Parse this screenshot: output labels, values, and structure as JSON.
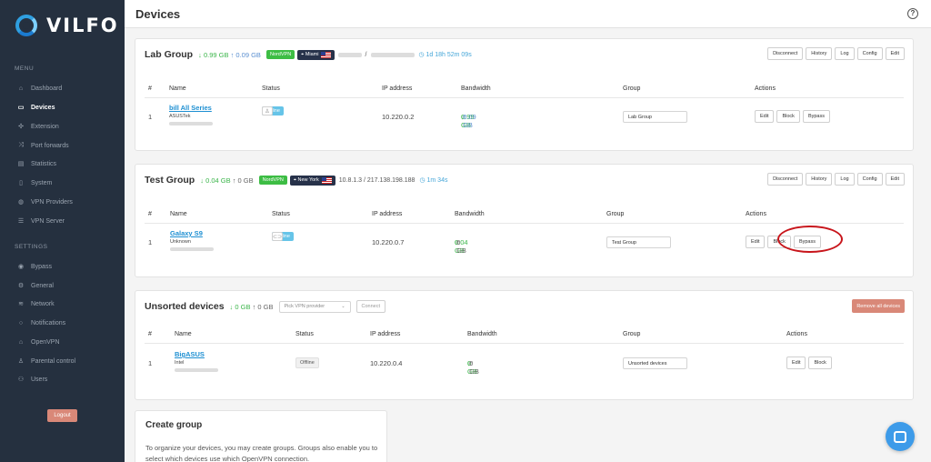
{
  "app": {
    "logo_text": "VILFO"
  },
  "sidebar": {
    "menu_label": "MENU",
    "menu_items": [
      {
        "label": "Dashboard",
        "icon": "home-icon"
      },
      {
        "label": "Devices",
        "icon": "laptop-icon",
        "active": true
      },
      {
        "label": "Extension",
        "icon": "puzzle-icon"
      },
      {
        "label": "Port forwards",
        "icon": "shuffle-icon"
      },
      {
        "label": "Statistics",
        "icon": "bar-chart-icon"
      },
      {
        "label": "System",
        "icon": "server-icon"
      },
      {
        "label": "VPN Providers",
        "icon": "globe-icon"
      },
      {
        "label": "VPN Server",
        "icon": "list-icon"
      }
    ],
    "settings_label": "SETTINGS",
    "settings_items": [
      {
        "label": "Bypass",
        "icon": "eye-icon"
      },
      {
        "label": "General",
        "icon": "gear-icon"
      },
      {
        "label": "Network",
        "icon": "wifi-icon"
      },
      {
        "label": "Notifications",
        "icon": "chat-icon"
      },
      {
        "label": "OpenVPN",
        "icon": "lock-icon"
      },
      {
        "label": "Parental control",
        "icon": "person-icon"
      },
      {
        "label": "Users",
        "icon": "users-icon"
      }
    ],
    "logout_label": "Logout"
  },
  "header": {
    "title": "Devices",
    "help_glyph": "?"
  },
  "groups": {
    "lab": {
      "title": "Lab Group",
      "down": "0.99 GB",
      "up": "0.09 GB",
      "vpn_badge": "NordVPN",
      "location": "Miami",
      "ip_separator": "/",
      "uptime": "1d 18h 52m 09s",
      "actions": [
        "Disconnect",
        "History",
        "Log",
        "Config",
        "Edit"
      ],
      "columns": [
        "#",
        "Name",
        "Status",
        "IP address",
        "Bandwidth",
        "Group",
        "Actions"
      ],
      "device": {
        "index": "1",
        "name": "bill All Series",
        "vendor": "ASUSTek",
        "status": "Online",
        "ip": "10.220.0.2",
        "down": "0.99 GB",
        "up": "0.09 GB",
        "group": "Lab Group",
        "actions": [
          "Edit",
          "Block",
          "Bypass"
        ]
      }
    },
    "test": {
      "title": "Test Group",
      "down": "0.04 GB",
      "up": "0 GB",
      "vpn_badge": "NordVPN",
      "location": "New York",
      "ip_info": "10.8.1.3 / 217.138.198.188",
      "uptime": "1m 34s",
      "actions": [
        "Disconnect",
        "History",
        "Log",
        "Config",
        "Edit"
      ],
      "columns": [
        "#",
        "Name",
        "Status",
        "IP address",
        "Bandwidth",
        "Group",
        "Actions"
      ],
      "device": {
        "index": "1",
        "name": "Galaxy S9",
        "vendor": "Unknown",
        "status": "Online",
        "ip": "10.220.0.7",
        "down": "0.04 GB",
        "up": "0 GB",
        "group": "Test Group",
        "actions": [
          "Edit",
          "Block",
          "Bypass"
        ]
      }
    },
    "unsorted": {
      "title": "Unsorted devices",
      "down": "0 GB",
      "up": "0 GB",
      "vpn_placeholder": "Pick VPN provider",
      "connect_label": "Connect",
      "remove_all_label": "Remove all devices",
      "columns": [
        "#",
        "Name",
        "Status",
        "IP address",
        "Bandwidth",
        "Group",
        "Actions"
      ],
      "device": {
        "index": "1",
        "name": "BigASUS",
        "vendor": "Intel",
        "status": "Offline",
        "ip": "10.220.0.4",
        "down": "0 GB",
        "up": "0 GB",
        "group": "Unsorted devices",
        "actions": [
          "Edit",
          "Block"
        ]
      }
    }
  },
  "create_group": {
    "title": "Create group",
    "description": "To organize your devices, you may create groups. Groups also enable you to select which devices use which OpenVPN connection."
  },
  "colors": {
    "accent": "#1d8fd2",
    "sidebar_bg": "#25303f",
    "success": "#3bb54a",
    "danger": "#d98878",
    "highlight_ring": "#c8151b"
  }
}
